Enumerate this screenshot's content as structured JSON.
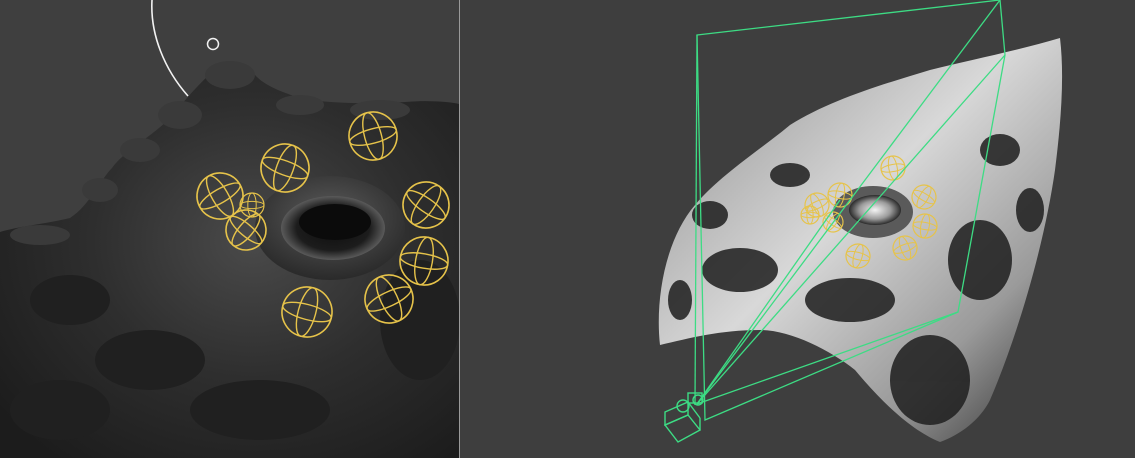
{
  "colors": {
    "viewport_background": "#3f3f3f",
    "divider": "#9a9a9a",
    "gizmo_yellow": "#e6c34a",
    "camera_green": "#3ddc84",
    "light_arc": "#f2f2f2"
  },
  "viewports": [
    {
      "shading": "dark",
      "gizmo_count": 9,
      "elements": [
        "crater-mesh",
        "rotation-gizmos",
        "light-arc"
      ]
    },
    {
      "shading": "lit",
      "gizmo_count": 9,
      "elements": [
        "terrain-surface",
        "rotation-gizmos",
        "camera-frustum",
        "camera-object"
      ]
    }
  ]
}
